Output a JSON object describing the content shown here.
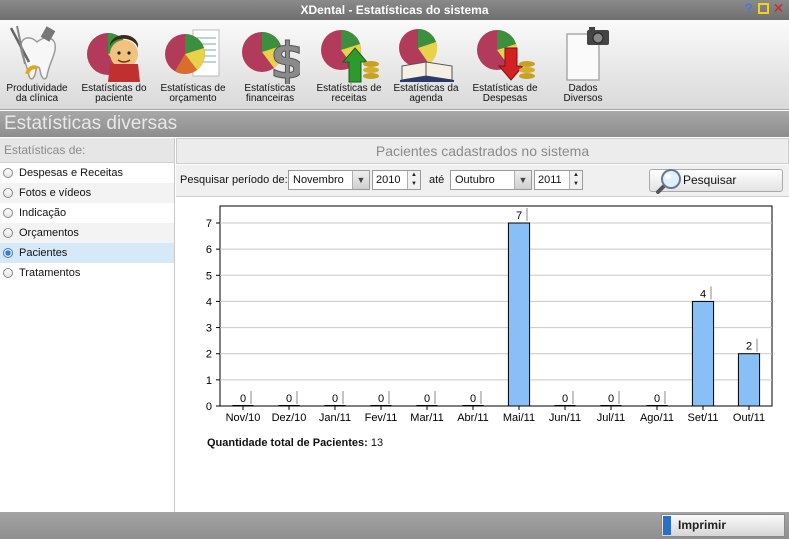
{
  "window": {
    "title": "XDental - Estatísticas do sistema",
    "help_glyph": "?",
    "close_glyph": "✕"
  },
  "toolbar": {
    "items": [
      {
        "line1": "Produtividade",
        "line2": "da clínica",
        "icon": "tooth-tools-icon"
      },
      {
        "line1": "Estatísticas do",
        "line2": "paciente",
        "icon": "pie-patient-icon"
      },
      {
        "line1": "Estatísticas de",
        "line2": "orçamento",
        "icon": "pie-budget-icon"
      },
      {
        "line1": "Estatísticas",
        "line2": "financeiras",
        "icon": "pie-dollar-icon"
      },
      {
        "line1": "Estatísticas de",
        "line2": "receitas",
        "icon": "pie-income-icon"
      },
      {
        "line1": "Estatísticas da",
        "line2": "agenda",
        "icon": "pie-agenda-icon"
      },
      {
        "line1": "Estatísticas de",
        "line2": "Despesas",
        "icon": "pie-expense-icon"
      },
      {
        "line1": "Dados",
        "line2": "Diversos",
        "icon": "doc-camera-icon"
      }
    ]
  },
  "section": {
    "title": "Estatísticas diversas"
  },
  "sidebar": {
    "heading": "Estatísticas de:",
    "options": [
      {
        "label": "Despesas e Receitas",
        "selected": false
      },
      {
        "label": "Fotos e vídeos",
        "selected": false
      },
      {
        "label": "Indicação",
        "selected": false
      },
      {
        "label": "Orçamentos",
        "selected": false
      },
      {
        "label": "Pacientes",
        "selected": true
      },
      {
        "label": "Tratamentos",
        "selected": false
      }
    ]
  },
  "panel": {
    "title": "Pacientes cadastrados no sistema"
  },
  "filter": {
    "period_label": "Pesquisar período de:",
    "from_month": "Novembro",
    "from_year": "2010",
    "until_label": "até",
    "to_month": "Outubro",
    "to_year": "2011",
    "search_label": "Pesquisar",
    "combo_arrow": "▼",
    "spin_up": "▲",
    "spin_down": "▼"
  },
  "chart_data": {
    "type": "bar",
    "categories": [
      "Nov/10",
      "Dez/10",
      "Jan/11",
      "Fev/11",
      "Mar/11",
      "Abr/11",
      "Mai/11",
      "Jun/11",
      "Jul/11",
      "Ago/11",
      "Set/11",
      "Out/11"
    ],
    "values": [
      0,
      0,
      0,
      0,
      0,
      0,
      7,
      0,
      0,
      0,
      4,
      2
    ],
    "ylim": [
      0,
      7
    ],
    "yticks": [
      0,
      1,
      2,
      3,
      4,
      5,
      6,
      7
    ],
    "grid": true,
    "bar_color": "#88bff7",
    "title": "",
    "xlabel": "",
    "ylabel": ""
  },
  "summary": {
    "total_label": "Quantidade total de Pacientes:",
    "total_value": "13"
  },
  "footer": {
    "print_label": "Imprimir"
  }
}
